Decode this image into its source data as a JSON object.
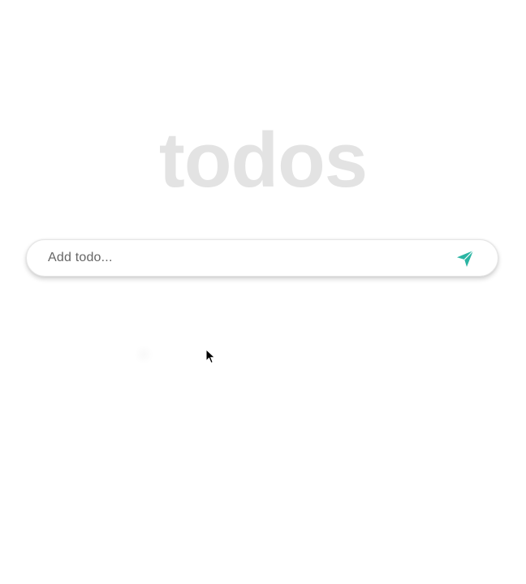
{
  "app": {
    "title": "todos"
  },
  "todo_form": {
    "placeholder": "Add todo...",
    "value": "",
    "send_icon": "send-icon"
  },
  "colors": {
    "title": "#e3e3e3",
    "accent": "#2bb5a3",
    "background": "#ffffff"
  },
  "todos": []
}
